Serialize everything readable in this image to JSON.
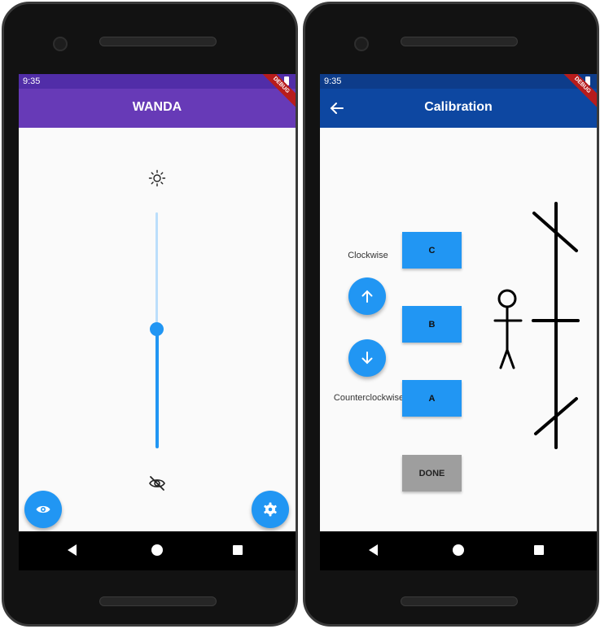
{
  "status": {
    "time": "9:35",
    "debug_banner": "DEBUG"
  },
  "left_phone": {
    "app_title": "WANDA",
    "brightness_slider": {
      "level": 0.5
    },
    "colors": {
      "appbar": "#673ab7",
      "status": "#512da8",
      "accent": "#2196f3"
    }
  },
  "right_phone": {
    "app_title": "Calibration",
    "clockwise_label": "Clockwise",
    "counterclockwise_label": "Counterclockwise",
    "buttons": {
      "c": "C",
      "b": "B",
      "a": "A",
      "done": "DONE"
    },
    "colors": {
      "appbar": "#0d47a1",
      "status": "#0d3c8a",
      "accent": "#2196f3",
      "done": "#9e9e9e"
    }
  },
  "icons": {
    "brightness": "sun-icon",
    "visibility_off": "eye-off-icon",
    "visibility": "eye-icon",
    "settings": "gear-icon",
    "back": "arrow-back-icon",
    "up": "arrow-up-icon",
    "down": "arrow-down-icon"
  }
}
